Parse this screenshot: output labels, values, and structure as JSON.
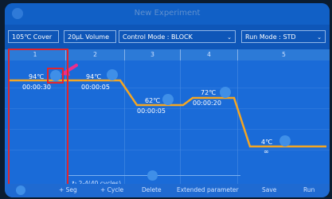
{
  "header": {
    "title": "New Experiment"
  },
  "controls": {
    "cover": "105℃ Cover",
    "volume": "20μL Volume",
    "control_mode": "Control Mode : BLOCK",
    "run_mode": "Run Mode : STD"
  },
  "stages": [
    "1",
    "2",
    "3",
    "4",
    "5"
  ],
  "steps": [
    {
      "temp": "94℃",
      "time": "00:00:30"
    },
    {
      "temp": "94℃",
      "time": "00:00:05"
    },
    {
      "temp": "62℃",
      "time": "00:00:05"
    },
    {
      "temp": "72℃",
      "time": "00:00:20"
    },
    {
      "temp": "4℃",
      "time": "∞"
    }
  ],
  "cycle_label": "2-4(40 cycles)",
  "toolbar": {
    "add_seg": "+ Seg",
    "add_cycle": "+ Cycle",
    "delete": "Delete",
    "extended": "Extended parameter",
    "save": "Save",
    "run": "Run"
  },
  "colors": {
    "accent_line": "#f4a623",
    "annotation": "#e0252e",
    "arrow": "#ea2e8e"
  }
}
